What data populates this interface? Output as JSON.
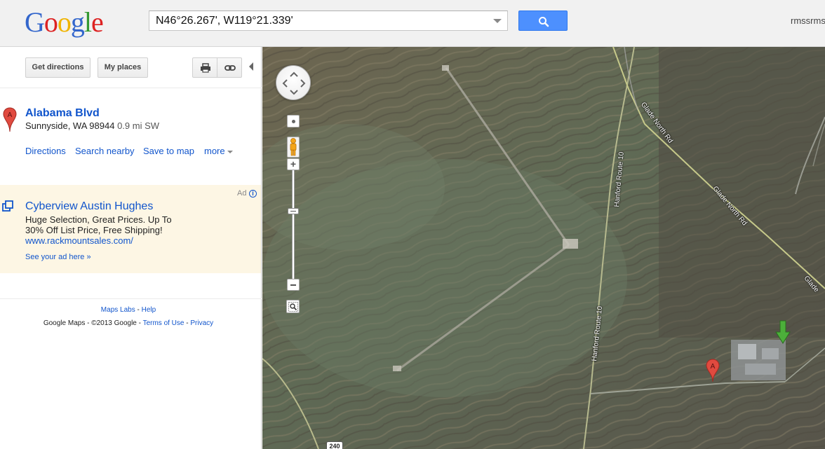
{
  "header": {
    "logo_letters": [
      {
        "char": "G",
        "color": "#3366cc"
      },
      {
        "char": "o",
        "color": "#dd2222"
      },
      {
        "char": "o",
        "color": "#f0b400"
      },
      {
        "char": "g",
        "color": "#3366cc"
      },
      {
        "char": "l",
        "color": "#339933"
      },
      {
        "char": "e",
        "color": "#dd2222"
      }
    ],
    "search_value": "N46°26.267', W119°21.339'",
    "user_name": "rmssrms"
  },
  "toolbar": {
    "directions_label": "Get directions",
    "places_label": "My places",
    "print_icon": "printer-icon",
    "link_icon": "link-icon"
  },
  "result": {
    "marker": "A",
    "title": "Alabama Blvd",
    "address": "Sunnyside, WA 98944",
    "distance": "0.9 mi SW",
    "actions": {
      "directions": "Directions",
      "nearby": "Search nearby",
      "save": "Save to map",
      "more": "more"
    }
  },
  "ad": {
    "label": "Ad",
    "info_icon": "i",
    "title": "Cyberview Austin Hughes",
    "line1": "Huge Selection, Great Prices. Up To",
    "line2": "30% Off List Price, Free Shipping!",
    "url": "www.rackmountsales.com/",
    "see_your_ad": "See your ad here »"
  },
  "footer": {
    "labs": "Maps Labs",
    "sep1": " - ",
    "help": "Help",
    "copyright": "Google Maps - ©2013 Google - ",
    "terms": "Terms of Use",
    "sep2": " - ",
    "privacy": "Privacy"
  },
  "map": {
    "roads": {
      "glade_north": "Glade North Rd",
      "glade_north_2": "Glade North Rd",
      "glade_north_3": "Glade",
      "hanford_1": "Hanford Route 10",
      "hanford_2": "Hanford Route 10"
    },
    "route_shield": "240",
    "pin_marker": "A",
    "colors": {
      "terrain": "#6f6b58",
      "marker_red": "#e04a3f",
      "arrow_green": "#4caf3a"
    }
  }
}
